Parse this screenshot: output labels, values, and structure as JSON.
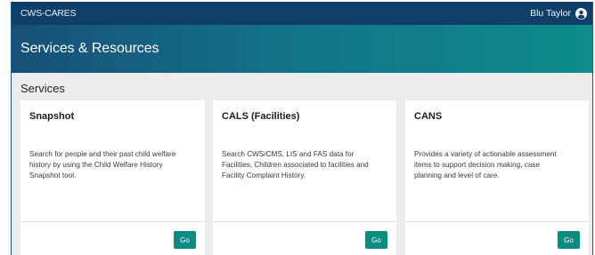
{
  "topbar": {
    "app_name": "CWS-CARES",
    "user_name": "Blu Taylor"
  },
  "header": {
    "title": "Services & Resources"
  },
  "section": {
    "title": "Services"
  },
  "cards": [
    {
      "title": "Snapshot",
      "description_lines": [
        "Search for people and their past child welfare",
        "history by using the Child Welfare History",
        "Snapshot tool."
      ],
      "button_label": "Go"
    },
    {
      "title": "CALS (Facilities)",
      "description_lines": [
        "Search CWS/CMS, LIS and FAS data for",
        "Facilities, Children associated to facilities and",
        "Facility Complaint History."
      ],
      "button_label": "Go"
    },
    {
      "title": "CANS",
      "description_lines": [
        "Provides a variety of actionable assessment",
        "items to support decision making, case",
        "planning and level of care."
      ],
      "button_label": "Go"
    }
  ],
  "colors": {
    "topbar": "#0f3e69",
    "header_gradient_start": "#174f78",
    "header_gradient_end": "#0f8c8a",
    "go_button": "#0f8a80"
  }
}
